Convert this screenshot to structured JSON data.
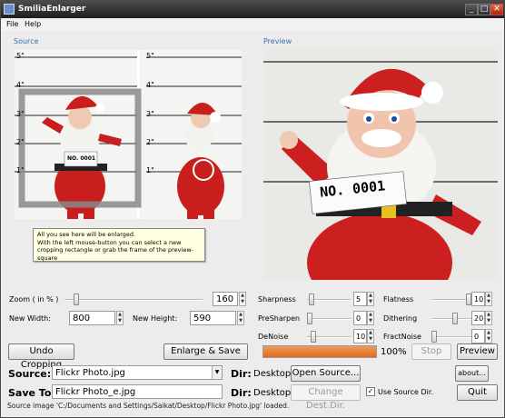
{
  "window": {
    "title": "SmiliaEnlarger",
    "min": "_",
    "max": "□",
    "close": "✕"
  },
  "menu": [
    "File",
    "Help"
  ],
  "source_label": "Source",
  "preview_label": "Preview",
  "ruler_marks": [
    "5\"",
    "4\"",
    "3\"",
    "2\"",
    "1\""
  ],
  "ruler_marks_right": [
    "5\"",
    "4\"",
    "3\"",
    "2\"",
    "1\""
  ],
  "santa_sign": "NO. 0001",
  "tooltip": [
    "All you see here will be enlarged.",
    "With the left mouse-button you can select a new",
    "cropping rectangle or grab the frame of the preview-square"
  ],
  "zoom": {
    "label": "Zoom  ( in % )",
    "value": "160",
    "slider": 0.07
  },
  "new_width": {
    "label": "New Width:",
    "value": "800"
  },
  "new_height": {
    "label": "New Height:",
    "value": "590"
  },
  "params": [
    {
      "label": "Sharpness",
      "value": "5",
      "slider": 0.05
    },
    {
      "label": "PreSharpen",
      "value": "0",
      "slider": 0.0
    },
    {
      "label": "DeNoise",
      "value": "10",
      "slider": 0.1
    },
    {
      "label": "Flatness",
      "value": "10",
      "slider": 1.0
    },
    {
      "label": "Dithering",
      "value": "20",
      "slider": 0.6
    },
    {
      "label": "FractNoise",
      "value": "0",
      "slider": 0.0
    }
  ],
  "buttons": {
    "undo": "Undo Cropping",
    "enlarge": "Enlarge & Save",
    "stop": "Stop",
    "preview": "Preview",
    "open_source": "Open Source...",
    "change_dir": "Change Dest.Dir.",
    "about": "about...",
    "quit": "Quit"
  },
  "progress": {
    "value": 1.0,
    "text": "100%"
  },
  "source": {
    "label": "Source:",
    "file": "Flickr Photo.jpg",
    "dir_label": "Dir:",
    "dir": "Desktop"
  },
  "save_to": {
    "label": "Save To:",
    "file": "Flickr Photo_e.jpg",
    "dir_label": "Dir:",
    "dir": "Desktop",
    "use_source_dir": "Use Source Dir.",
    "use_source_checked": "✓"
  },
  "status": "Source image 'C:/Documents and Settings/Saikat/Desktop/Flickr Photo.jpg' loaded."
}
